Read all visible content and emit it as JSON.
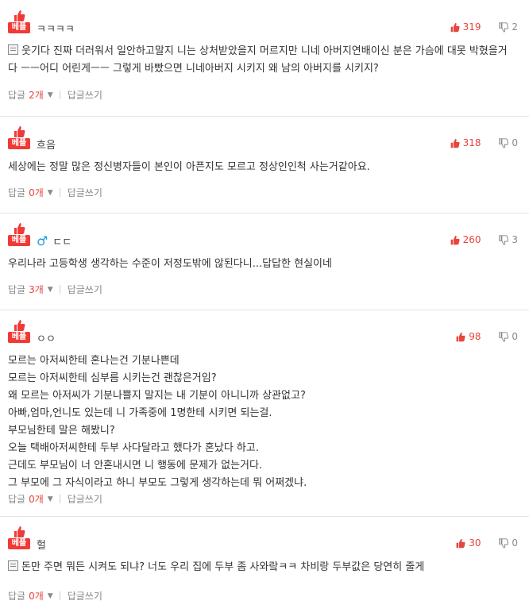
{
  "comments": [
    {
      "best_label": "베플",
      "nickname": "ㅋㅋㅋㅋ",
      "gender": "",
      "up": "319",
      "down": "2",
      "has_image": true,
      "lines": [
        "웃기다 진짜 더러워서 일안하고말지 니는 상처받았을지 머르지만 니네 아버지연배이신 분은 가슴에 대못 박혔을거다 ㅡㅡ어디 어린게ㅡㅡ 그렇게 바빴으면 니네아버지 시키지 왜 남의 아버지를 시키지?"
      ],
      "reply_label": "답글",
      "reply_count": "2개",
      "write_label": "답글쓰기"
    },
    {
      "best_label": "베플",
      "nickname": "흐음",
      "gender": "",
      "up": "318",
      "down": "0",
      "has_image": false,
      "lines": [
        "세상에는 정말 많은 정신병자들이 본인이 아픈지도 모르고 정상인인척 사는거같아요."
      ],
      "reply_label": "답글",
      "reply_count": "0개",
      "write_label": "답글쓰기"
    },
    {
      "best_label": "베플",
      "nickname": "ㄷㄷ",
      "gender": "♂",
      "up": "260",
      "down": "3",
      "has_image": false,
      "lines": [
        "우리나라 고등학생 생각하는 수준이 저정도밖에 않된다니...답답한 현실이네"
      ],
      "reply_label": "답글",
      "reply_count": "3개",
      "write_label": "답글쓰기"
    },
    {
      "best_label": "베플",
      "nickname": "ㅇㅇ",
      "gender": "",
      "up": "98",
      "down": "0",
      "has_image": false,
      "lines": [
        "모르는 아저씨한테 혼나는건 기분나쁜데",
        "모르는 아저씨한테 심부름 시키는건 괜찮은거임?",
        "왜 모르는 아저씨가 기분나쁠지 말지는 내 기분이 아니니까 상관없고?",
        "아빠,엄마,언니도 있는데 니 가족중에 1명한테 시키면 되는걸.",
        "부모님한테 말은 해봤니?",
        "오늘 택배아저씨한테 두부 사다달라고 했다가 혼났다 하고.",
        "근데도 부모님이 너 안혼내시면 니 행동에 문제가 없는거다.",
        "그 부모에 그 자식이라고 하니 부모도 그렇게 생각하는데 뭐 어쩌겠냐."
      ],
      "reply_label": "답글",
      "reply_count": "0개",
      "write_label": "답글쓰기"
    },
    {
      "best_label": "베플",
      "nickname": "헐",
      "gender": "",
      "up": "30",
      "down": "0",
      "has_image": true,
      "lines": [
        "돈만 주면 뭐든 시켜도 되냐? 너도 우리 집에 두부 좀 사와랔ㅋㅋ 차비랑 두부값은 당연히 줄게"
      ],
      "reply_label": "답글",
      "reply_count": "0개",
      "write_label": "답글쓰기"
    }
  ]
}
